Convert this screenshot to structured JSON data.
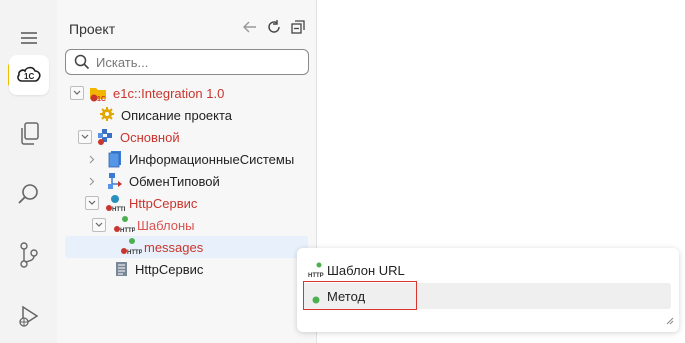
{
  "activity_bar": {
    "items": [
      {
        "name": "1c-cloud-icon",
        "active": true
      },
      {
        "name": "files-icon"
      },
      {
        "name": "search-icon"
      },
      {
        "name": "source-control-icon"
      },
      {
        "name": "run-debug-icon"
      }
    ]
  },
  "explorer": {
    "title": "Проект",
    "search": {
      "placeholder": "Искать...",
      "value": ""
    },
    "tree": [
      {
        "label": "e1c::Integration 1.0",
        "icon": "project-folder-icon",
        "expanded": true
      },
      {
        "label": "Описание проекта",
        "icon": "gear-icon"
      },
      {
        "label": "Основной",
        "icon": "subsystem-icon",
        "expanded": true
      },
      {
        "label": "ИнформационныеСистемы",
        "icon": "catalog-icon",
        "expanded": false
      },
      {
        "label": "ОбменТиповой",
        "icon": "exchange-icon",
        "expanded": false
      },
      {
        "label": "HttpСервис",
        "icon": "http-service-icon",
        "expanded": true
      },
      {
        "label": "Шаблоны",
        "icon": "http-template-icon",
        "expanded": true
      },
      {
        "label": "messages",
        "icon": "http-template-icon",
        "selected": true
      },
      {
        "label": "HttpСервис",
        "icon": "module-icon"
      }
    ]
  },
  "popup": {
    "items": [
      {
        "label": "Шаблон URL",
        "icon": "http-icon"
      },
      {
        "label": "Метод",
        "icon": "green-dot-icon",
        "highlighted": true
      }
    ]
  },
  "colors": {
    "accent_yellow": "#f5c400",
    "error_red": "#c9352c",
    "status_green": "#4caf50",
    "focus_outline": "#d9362f"
  }
}
